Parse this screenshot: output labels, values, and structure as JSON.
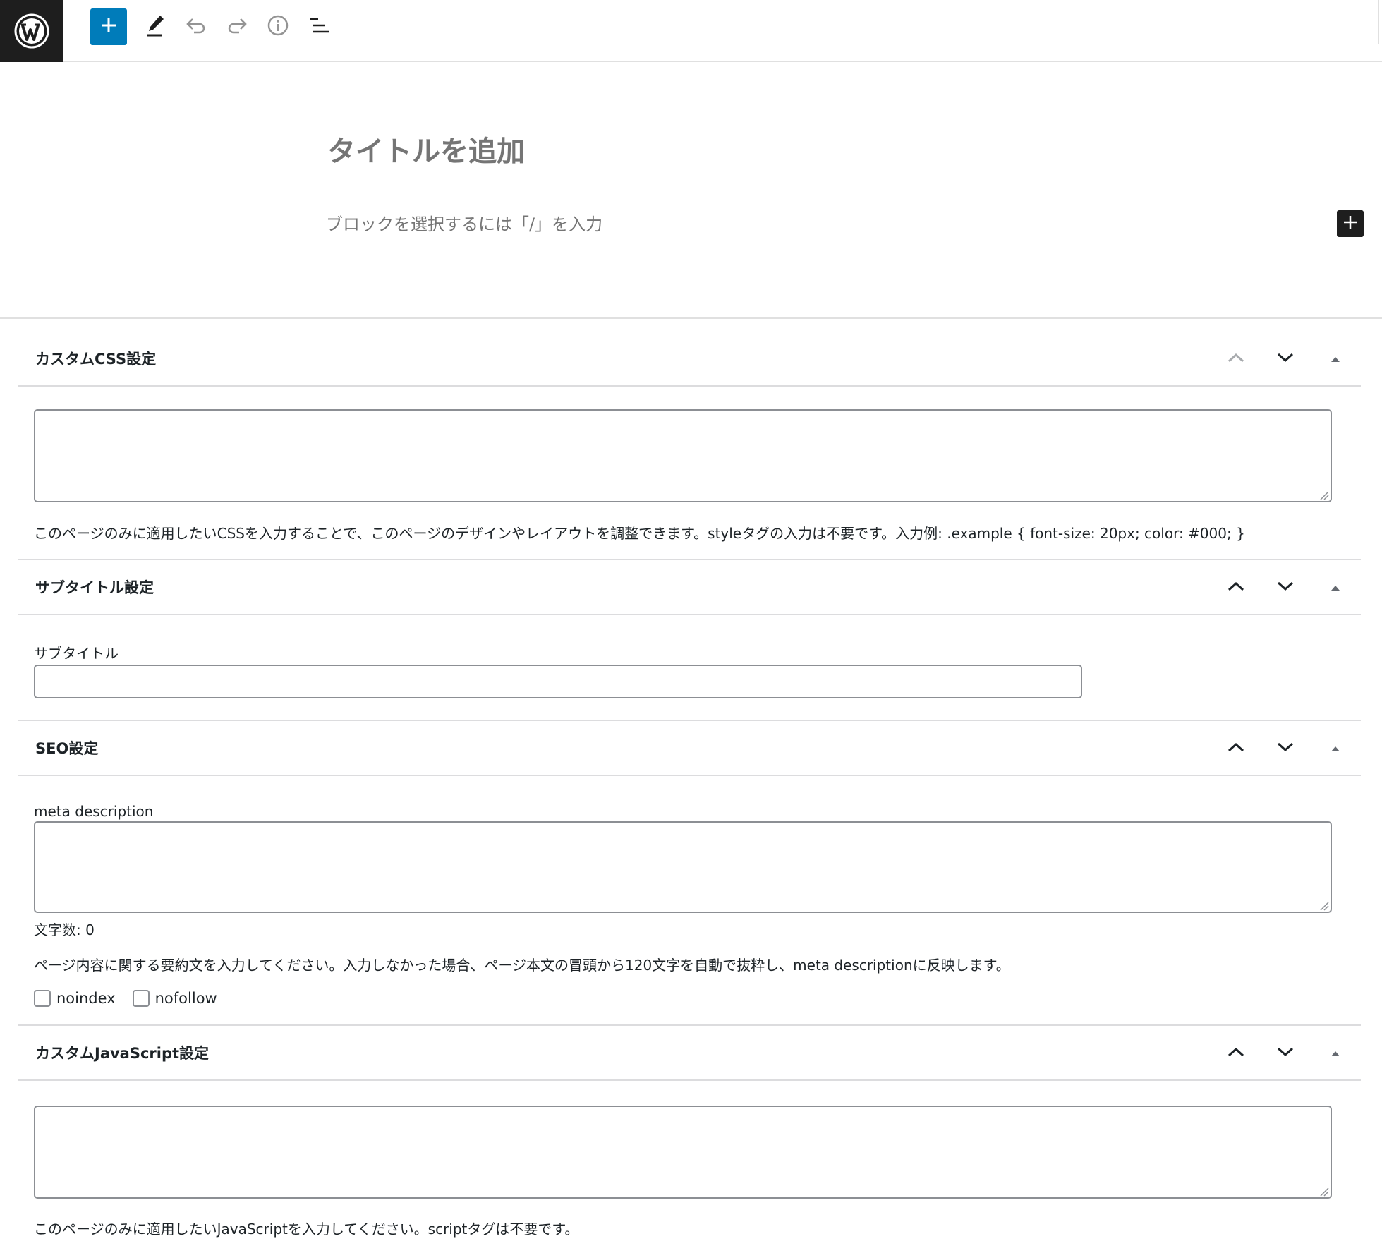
{
  "toolbar": {
    "logo": "wordpress-logo",
    "icons": [
      "plus-icon",
      "pencil-icon",
      "undo-icon",
      "redo-icon",
      "info-icon",
      "list-view-icon"
    ],
    "accent_color": "#007cba"
  },
  "editor": {
    "title_placeholder": "タイトルを追加",
    "block_placeholder": "ブロックを選択するには「/」を入力"
  },
  "metaboxes": {
    "css": {
      "title": "カスタムCSS設定",
      "description": "このページのみに適用したいCSSを入力することで、このページのデザインやレイアウトを調整できます。styleタグの入力は不要です。入力例: .example { font-size: 20px; color: #000; }"
    },
    "subtitle": {
      "title": "サブタイトル設定",
      "field_label": "サブタイトル"
    },
    "seo": {
      "title": "SEO設定",
      "field_label": "meta description",
      "char_count": "文字数: 0",
      "description": "ページ内容に関する要約文を入力してください。入力しなかった場合、ページ本文の冒頭から120文字を自動で抜粋し、meta descriptionに反映します。",
      "noindex_label": "noindex",
      "nofollow_label": "nofollow"
    },
    "js": {
      "title": "カスタムJavaScript設定",
      "description": "このページのみに適用したいJavaScriptを入力してください。scriptタグは不要です。"
    }
  }
}
